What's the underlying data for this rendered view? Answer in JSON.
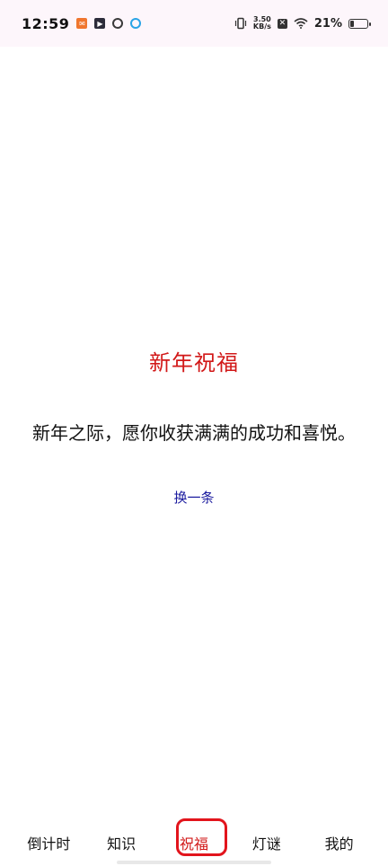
{
  "status_bar": {
    "time": "12:59",
    "network_speed_value": "3.50",
    "network_speed_unit": "KB/s",
    "battery_percent": "21%",
    "battery_level": 0.21
  },
  "main": {
    "title": "新年祝福",
    "blessing_text": "新年之际，愿你收获满满的成功和喜悦。",
    "change_button_label": "换一条"
  },
  "bottom_nav": {
    "items": [
      {
        "label": "倒计时"
      },
      {
        "label": "知识"
      },
      {
        "label": "祝福"
      },
      {
        "label": "灯谜"
      },
      {
        "label": "我的"
      }
    ],
    "active_index": 2
  },
  "colors": {
    "title": "#d21919",
    "link": "#1a1a9e",
    "active_ring": "#e2141c"
  }
}
